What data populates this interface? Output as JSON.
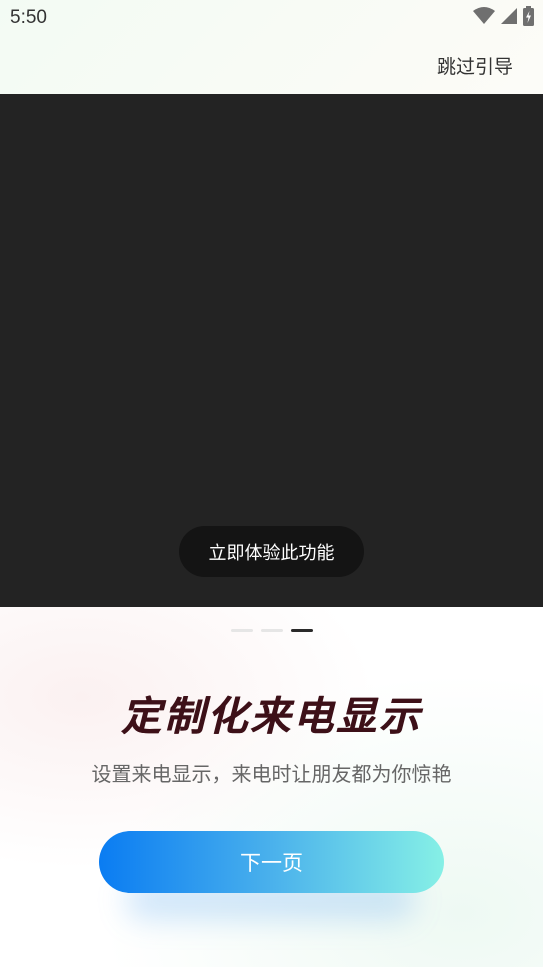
{
  "status_bar": {
    "time": "5:50",
    "icons": [
      "wifi-icon",
      "signal-icon",
      "battery-charging-icon"
    ]
  },
  "header": {
    "skip_label": "跳过引导"
  },
  "video": {
    "try_button_label": "立即体验此功能"
  },
  "pager": {
    "total": 3,
    "current": 3
  },
  "content": {
    "title": "定制化来电显示",
    "subtitle": "设置来电显示，来电时让朋友都为你惊艳",
    "next_label": "下一页"
  },
  "colors": {
    "title": "#3d1018",
    "button_gradient_start": "#0a7cf2",
    "button_gradient_end": "#86f0e6",
    "video_bg": "#232323"
  }
}
